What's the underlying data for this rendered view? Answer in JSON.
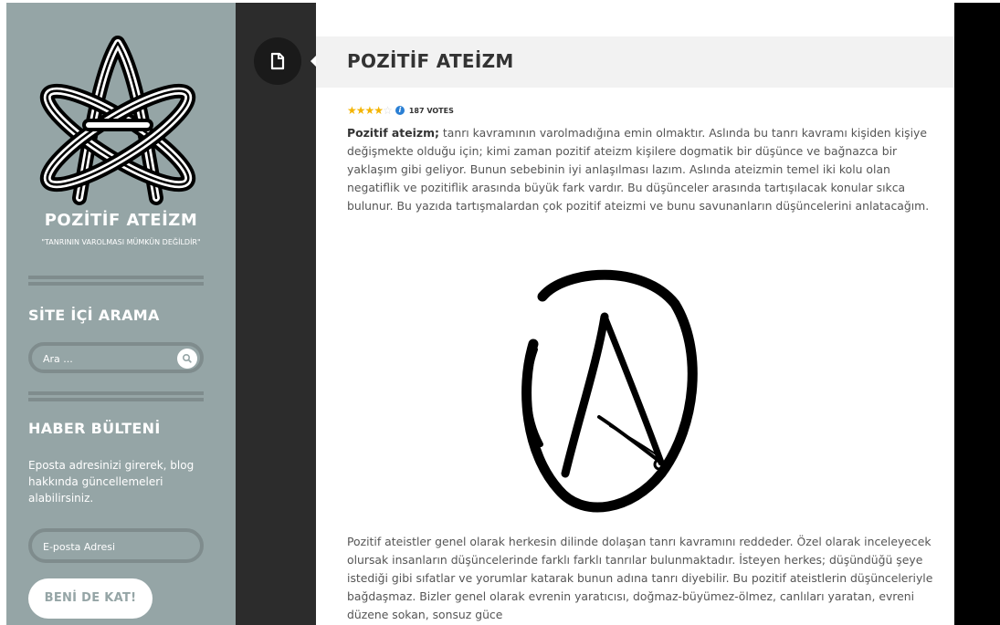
{
  "site": {
    "title": "POZİTİF ATEİZM",
    "tagline": "\"TANRININ VAROLMASI MÜMKÜN DEĞİLDİR\""
  },
  "sidebar": {
    "search_title": "SİTE İÇİ ARAMA",
    "search_placeholder": "Ara ...",
    "newsletter_title": "HABER BÜLTENİ",
    "newsletter_text": "Eposta adresinizi girerek, blog hakkında güncellemeleri alabilirsiniz.",
    "email_placeholder": "E-posta Adresi",
    "join_label": "BENİ DE KAT!"
  },
  "post": {
    "title": "POZİTİF ATEİZM",
    "rating": {
      "stars": 4,
      "out_of": 5,
      "votes": "187 VOTES"
    },
    "intro_bold": "Pozitif ateizm;",
    "intro_rest": " tanrı kavramının varolmadığına emin olmaktır. Aslında bu tanrı kavramı kişiden kişiye değişmekte olduğu için; kimi zaman pozitif ateizm kişilere dogmatik bir düşünce ve bağnazca bir yaklaşım gibi geliyor. Bunun sebebinin iyi anlaşılması lazım. Aslında ateizmin temel iki kolu olan negatiflik ve pozitiflik arasında büyük fark vardır. Bu düşünceler arasında tartışılacak konular sıkca bulunur. Bu yazıda tartışmalardan çok pozitif ateizmi ve bunu savunanların düşüncelerini anlatacağım.",
    "second_paragraph": "Pozitif ateistler genel olarak herkesin dilinde dolaşan tanrı kavramını reddeder. Özel olarak inceleyecek olursak insanların düşüncelerinde farklı farklı tanrılar bulunmaktadır. İsteyen herkes; düşündüğü şeye istediği gibi sıfatlar ve yorumlar katarak bunun adına tanrı diyebilir. Bu pozitif ateistlerin düşünceleriyle bağdaşmaz. Bizler genel olarak evrenin yaratıcısı, doğmaz-büyümez-ölmez, canlıları yaratan, evreni düzene sokan, sonsuz güce"
  },
  "icons": {
    "post_type": "document-icon",
    "search": "search-icon",
    "info": "info-icon",
    "logo": "atomic-atheism-logo",
    "symbol": "atheist-a-symbol"
  },
  "colors": {
    "sidebar_bg": "#95a5a6",
    "dark_strip": "#2c2c2c",
    "star": "#f4b400",
    "info": "#2a7fd4"
  }
}
